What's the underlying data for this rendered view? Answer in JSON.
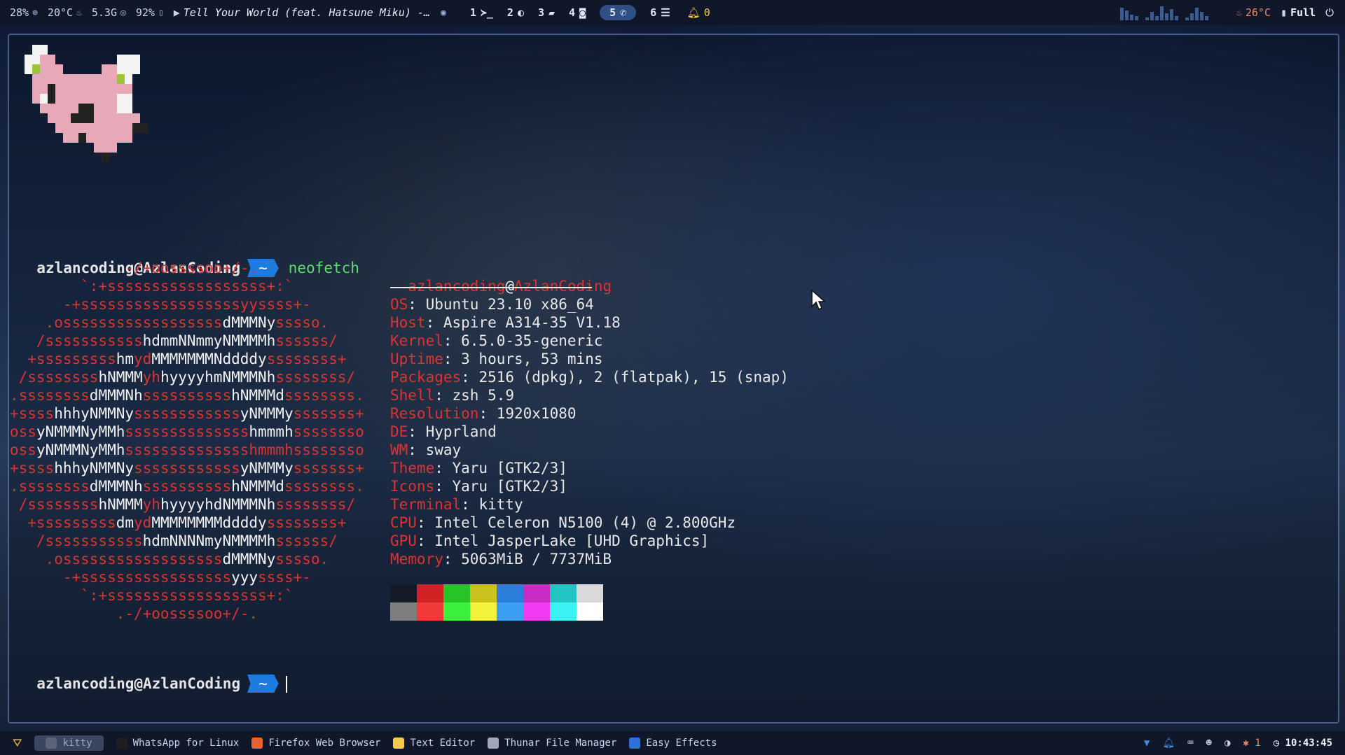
{
  "topbar": {
    "cpu": "28%",
    "temp": "20°C",
    "ram": "5.3G",
    "battery": "92%",
    "media_title": "Tell Your World (feat. Hatsune Miku) -…",
    "workspaces": [
      {
        "num": "1",
        "icon": "terminal-icon",
        "glyph": "≻_"
      },
      {
        "num": "2",
        "icon": "chrome-icon",
        "glyph": "◐"
      },
      {
        "num": "3",
        "icon": "folder-icon",
        "glyph": "▰"
      },
      {
        "num": "4",
        "icon": "camera-icon",
        "glyph": "◙"
      },
      {
        "num": "5",
        "icon": "whatsapp-icon",
        "glyph": "✆",
        "active": true
      },
      {
        "num": "6",
        "icon": "stack-icon",
        "glyph": "☰"
      }
    ],
    "notifications": "0",
    "weather_temp": "26°C",
    "battery_mode": "Full"
  },
  "terminal": {
    "prompt_user": "azlancoding@AzlanCoding",
    "prompt_dir": "~",
    "command": "neofetch",
    "header_user": "azlancoding",
    "header_at": "@",
    "header_host": "AzlanCoding",
    "info": [
      {
        "key": "OS",
        "value": ": Ubuntu 23.10 x86_64"
      },
      {
        "key": "Host",
        "value": ": Aspire A314-35 V1.18"
      },
      {
        "key": "Kernel",
        "value": ": 6.5.0-35-generic"
      },
      {
        "key": "Uptime",
        "value": ": 3 hours, 53 mins"
      },
      {
        "key": "Packages",
        "value": ": 2516 (dpkg), 2 (flatpak), 15 (snap)"
      },
      {
        "key": "Shell",
        "value": ": zsh 5.9"
      },
      {
        "key": "Resolution",
        "value": ": 1920x1080"
      },
      {
        "key": "DE",
        "value": ": Hyprland"
      },
      {
        "key": "WM",
        "value": ": sway"
      },
      {
        "key": "Theme",
        "value": ": Yaru [GTK2/3]"
      },
      {
        "key": "Icons",
        "value": ": Yaru [GTK2/3]"
      },
      {
        "key": "Terminal",
        "value": ": kitty"
      },
      {
        "key": "CPU",
        "value": ": Intel Celeron N5100 (4) @ 2.800GHz"
      },
      {
        "key": "GPU",
        "value": ": Intel JasperLake [UHD Graphics]"
      },
      {
        "key": "Memory",
        "value": ": 5063MiB / 7737MiB"
      }
    ],
    "ascii": [
      [
        {
          "c": "r",
          "t": "            .-/+oossssoo+/-."
        }
      ],
      [
        {
          "c": "r",
          "t": "        `:+ssssssssssssssssss+:`"
        }
      ],
      [
        {
          "c": "r",
          "t": "      -+ssssssssssssssssssyyssss+-"
        }
      ],
      [
        {
          "c": "r",
          "t": "    .ossssssssssssssssss"
        },
        {
          "c": "w",
          "t": "dMMMNy"
        },
        {
          "c": "r",
          "t": "sssso."
        }
      ],
      [
        {
          "c": "r",
          "t": "   /sssssssssss"
        },
        {
          "c": "w",
          "t": "hdmmNNmmyNMMMMh"
        },
        {
          "c": "r",
          "t": "ssssss/"
        }
      ],
      [
        {
          "c": "r",
          "t": "  +sssssssss"
        },
        {
          "c": "w",
          "t": "hm"
        },
        {
          "c": "r",
          "t": "yd"
        },
        {
          "c": "w",
          "t": "MMMMMMMNddddy"
        },
        {
          "c": "r",
          "t": "ssssssss+"
        }
      ],
      [
        {
          "c": "r",
          "t": " /ssssssss"
        },
        {
          "c": "w",
          "t": "hNMMM"
        },
        {
          "c": "r",
          "t": "yh"
        },
        {
          "c": "w",
          "t": "hyyyyhmNMMMNh"
        },
        {
          "c": "r",
          "t": "ssssssss/"
        }
      ],
      [
        {
          "c": "r",
          "t": ".ssssssss"
        },
        {
          "c": "w",
          "t": "dMMMNh"
        },
        {
          "c": "r",
          "t": "ssssssssss"
        },
        {
          "c": "w",
          "t": "hNMMMd"
        },
        {
          "c": "r",
          "t": "ssssssss."
        }
      ],
      [
        {
          "c": "r",
          "t": "+ssss"
        },
        {
          "c": "w",
          "t": "hhhyNMMNy"
        },
        {
          "c": "r",
          "t": "ssssssssssss"
        },
        {
          "c": "w",
          "t": "yNMMMy"
        },
        {
          "c": "r",
          "t": "sssssss+"
        }
      ],
      [
        {
          "c": "r",
          "t": "oss"
        },
        {
          "c": "w",
          "t": "yNMMMNyMMh"
        },
        {
          "c": "r",
          "t": "ssssssssssssss"
        },
        {
          "c": "w",
          "t": "hmmmh"
        },
        {
          "c": "r",
          "t": "ssssssso"
        }
      ],
      [
        {
          "c": "r",
          "t": "oss"
        },
        {
          "c": "w",
          "t": "yNMMMNyMMh"
        },
        {
          "c": "r",
          "t": "sssssssssssssshmmmhssssssso"
        }
      ],
      [
        {
          "c": "r",
          "t": "+ssss"
        },
        {
          "c": "w",
          "t": "hhhyNMMNy"
        },
        {
          "c": "r",
          "t": "ssssssssssss"
        },
        {
          "c": "w",
          "t": "yNMMMy"
        },
        {
          "c": "r",
          "t": "sssssss+"
        }
      ],
      [
        {
          "c": "r",
          "t": ".ssssssss"
        },
        {
          "c": "w",
          "t": "dMMMNh"
        },
        {
          "c": "r",
          "t": "ssssssssss"
        },
        {
          "c": "w",
          "t": "hNMMMd"
        },
        {
          "c": "r",
          "t": "ssssssss."
        }
      ],
      [
        {
          "c": "r",
          "t": " /ssssssss"
        },
        {
          "c": "w",
          "t": "hNMMM"
        },
        {
          "c": "r",
          "t": "yh"
        },
        {
          "c": "w",
          "t": "hyyyyhdNMMMNh"
        },
        {
          "c": "r",
          "t": "ssssssss/"
        }
      ],
      [
        {
          "c": "r",
          "t": "  +sssssssss"
        },
        {
          "c": "w",
          "t": "dm"
        },
        {
          "c": "r",
          "t": "yd"
        },
        {
          "c": "w",
          "t": "MMMMMMMMddddy"
        },
        {
          "c": "r",
          "t": "ssssssss+"
        }
      ],
      [
        {
          "c": "r",
          "t": "   /sssssssssss"
        },
        {
          "c": "w",
          "t": "hdmNNNNmyNMMMMh"
        },
        {
          "c": "r",
          "t": "ssssss/"
        }
      ],
      [
        {
          "c": "r",
          "t": "    .ossssssssssssssssss"
        },
        {
          "c": "w",
          "t": "dMMMNy"
        },
        {
          "c": "r",
          "t": "sssso."
        }
      ],
      [
        {
          "c": "r",
          "t": "      -+sssssssssssssssss"
        },
        {
          "c": "w",
          "t": "yyy"
        },
        {
          "c": "r",
          "t": "ssss+-"
        }
      ],
      [
        {
          "c": "r",
          "t": "        `:+ssssssssssssssssss+:`"
        }
      ],
      [
        {
          "c": "r",
          "t": "            .-/+oossssoo+/-."
        }
      ]
    ],
    "palette_top": [
      "#151a28",
      "#d12323",
      "#26c426",
      "#c9c21c",
      "#2b7fdb",
      "#c92bc4",
      "#22c4c4",
      "#d9d9d9"
    ],
    "palette_bottom": [
      "#7f7f7f",
      "#f23a3a",
      "#3af03a",
      "#f2f23a",
      "#3a9ef2",
      "#f23af2",
      "#3af2f2",
      "#ffffff"
    ]
  },
  "taskbar": {
    "start_icon": "hyprland-icon",
    "tasks": [
      {
        "label": "kitty",
        "icon": "terminal-icon",
        "color": "#5a6478",
        "active": true
      },
      {
        "label": "WhatsApp for Linux",
        "icon": "whatsapp-icon",
        "color": "#1e1e1e"
      },
      {
        "label": "Firefox Web Browser",
        "icon": "firefox-icon",
        "color": "#e8632b"
      },
      {
        "label": "Text Editor",
        "icon": "text-editor-icon",
        "color": "#f2c94c"
      },
      {
        "label": "Thunar File Manager",
        "icon": "thunar-icon",
        "color": "#a0a8b8"
      },
      {
        "label": "Easy Effects",
        "icon": "easy-effects-icon",
        "color": "#2f6fdb"
      }
    ],
    "tray_bluetooth_count": "1",
    "clock": "10:43:45"
  }
}
